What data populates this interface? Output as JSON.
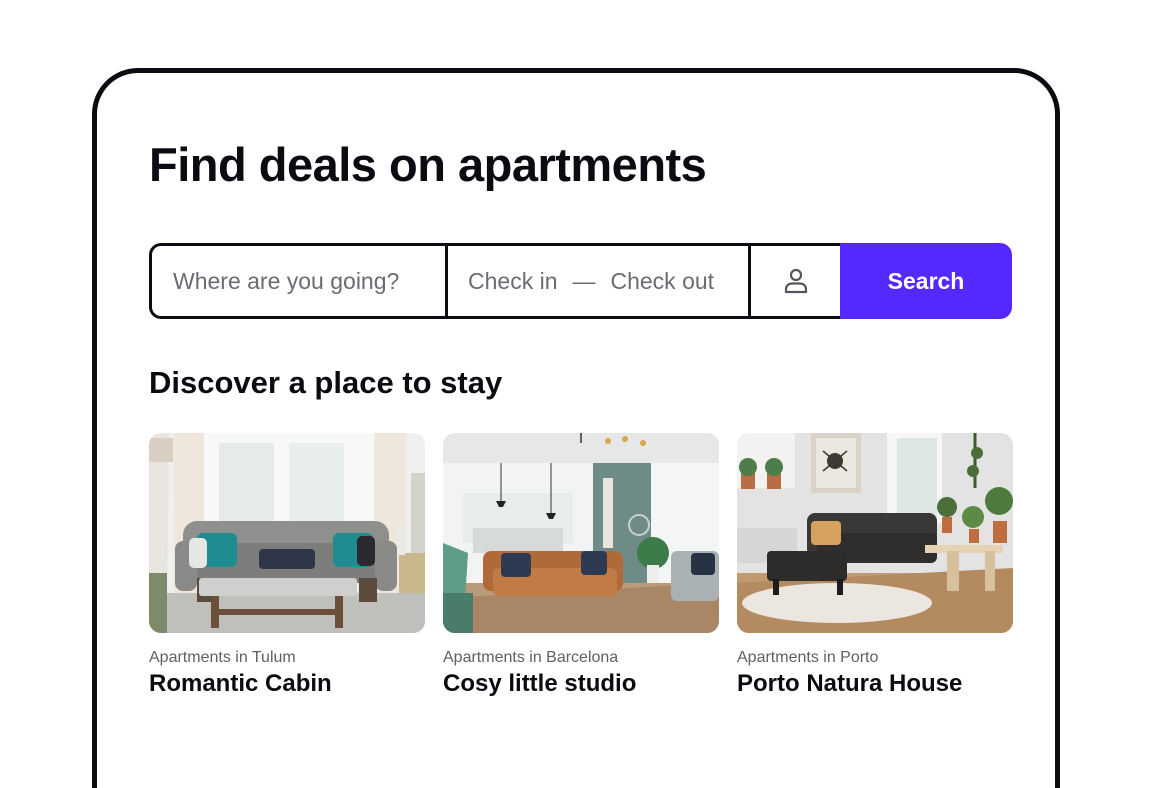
{
  "page": {
    "title": "Find deals on apartments",
    "accent_color": "#5528ff"
  },
  "search": {
    "destination_placeholder": "Where are you going?",
    "check_in_label": "Check in",
    "date_separator": "—",
    "check_out_label": "Check out",
    "guests_icon": "person-icon",
    "button_label": "Search"
  },
  "discover": {
    "heading": "Discover a place to stay",
    "listings": [
      {
        "subtitle": "Apartments in Tulum",
        "title": "Romantic Cabin",
        "photo": "living-room-grey-sofa"
      },
      {
        "subtitle": "Apartments in Barcelona",
        "title": "Cosy little studio",
        "photo": "living-room-tan-leather-sofa"
      },
      {
        "subtitle": "Apartments in Porto",
        "title": "Porto Natura House",
        "photo": "living-room-dark-sofa-plants"
      }
    ]
  }
}
